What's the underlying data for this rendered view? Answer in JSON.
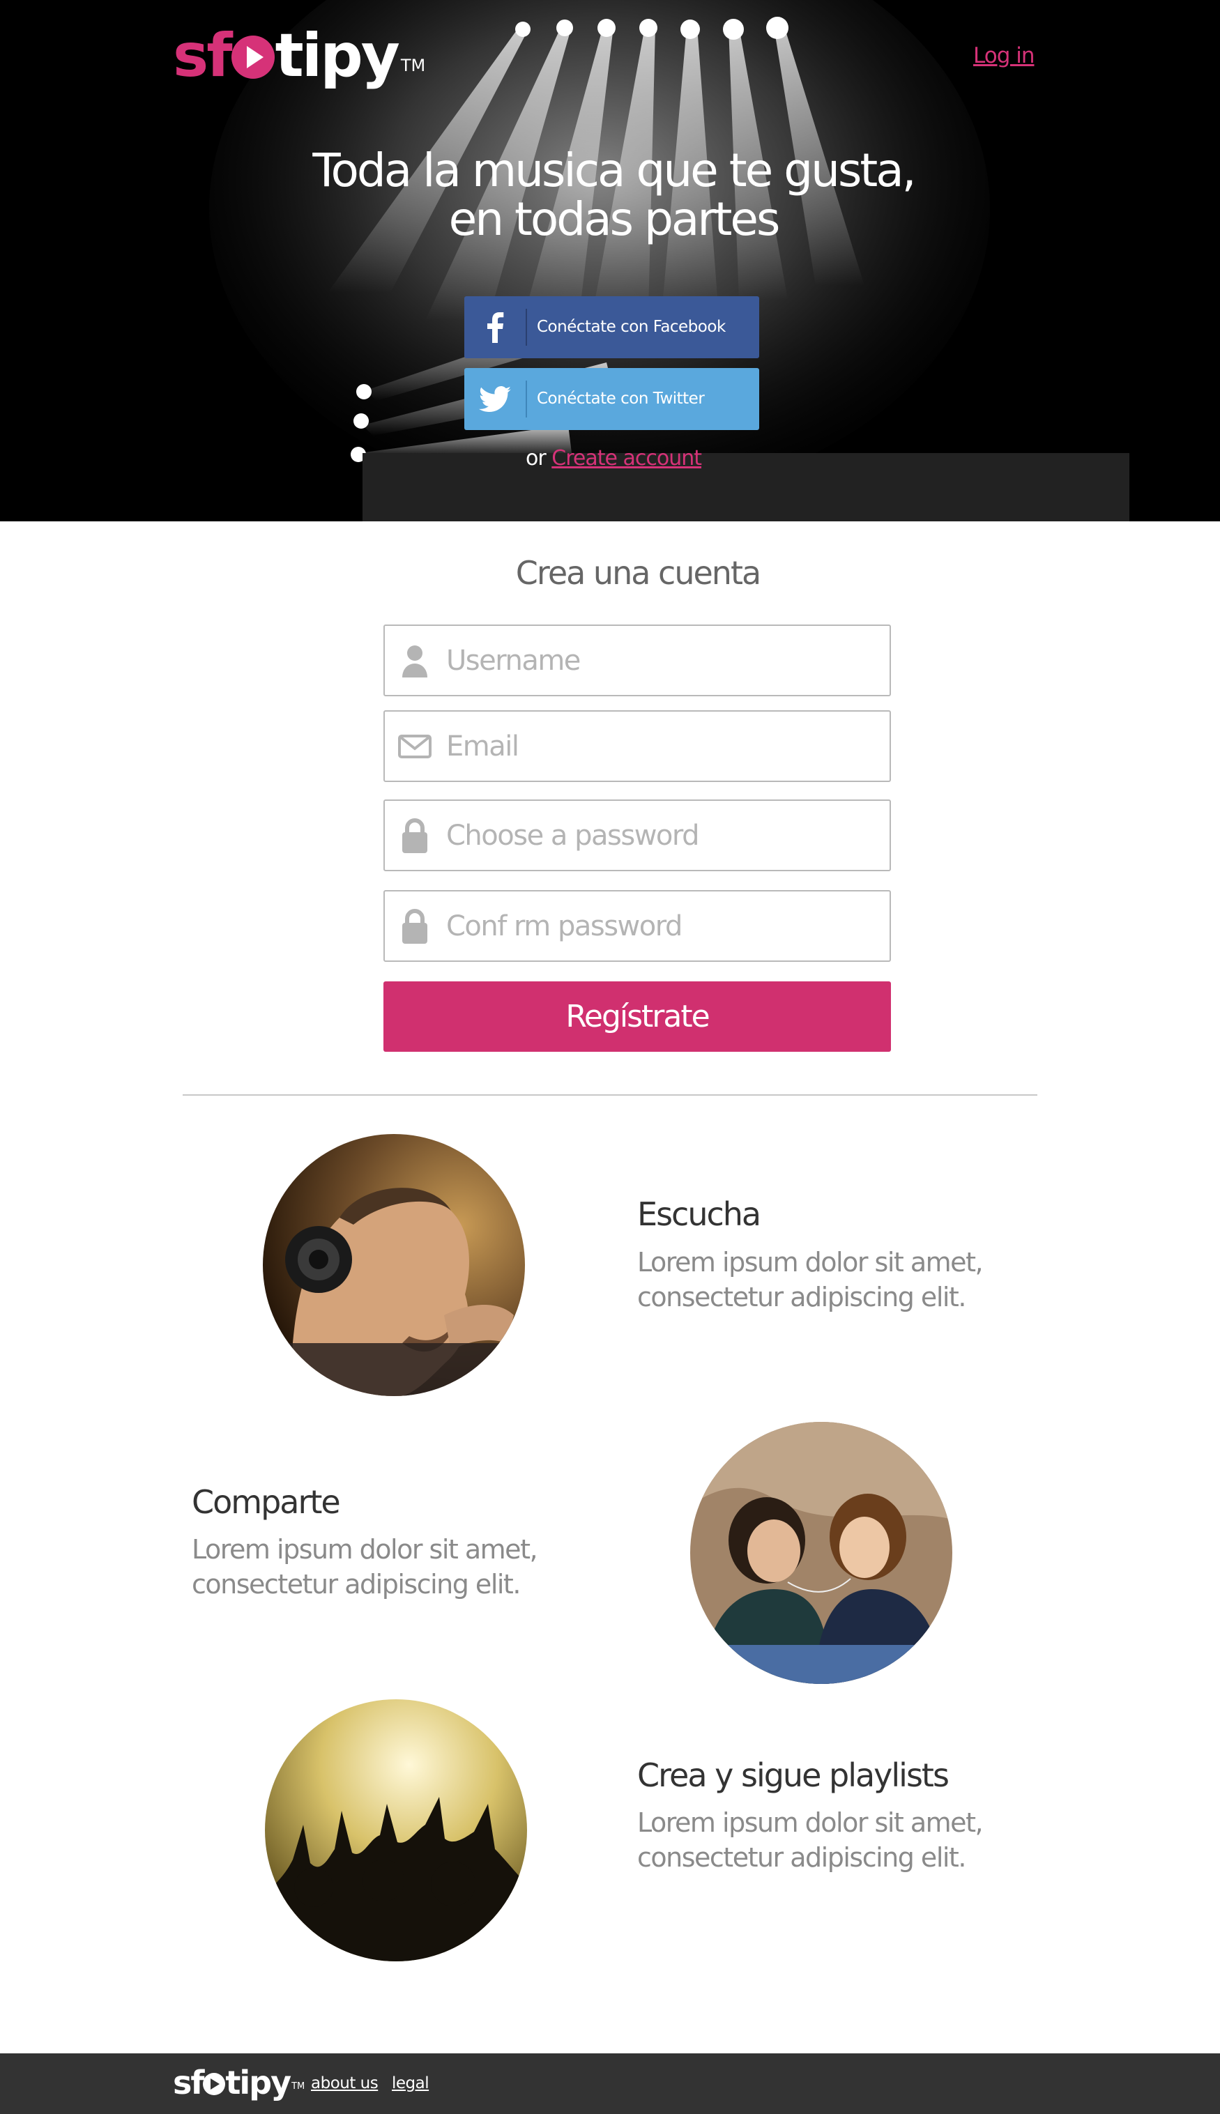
{
  "brand": {
    "logo_part1": "sf",
    "logo_part2": "tipy",
    "logo_tm": "TM",
    "accent_color": "#d63278"
  },
  "header": {
    "login_label": "Log in"
  },
  "hero": {
    "headline_line1": "Toda la musica que te gusta,",
    "headline_line2": "en todas partes",
    "facebook_label": "Conéctate con Facebook",
    "facebook_icon": "facebook-icon",
    "facebook_color": "#3b5998",
    "twitter_label": "Conéctate con Twitter",
    "twitter_icon": "twitter-icon",
    "twitter_color": "#5aa8dd",
    "or_text": "or",
    "create_account_label": "Create account"
  },
  "signup": {
    "title": "Crea una cuenta",
    "fields": [
      {
        "placeholder": "Username",
        "value": "",
        "icon": "user-icon"
      },
      {
        "placeholder": "Email",
        "value": "",
        "icon": "envelope-icon"
      },
      {
        "placeholder": "Choose a password",
        "value": "",
        "icon": "lock-icon"
      },
      {
        "placeholder": "Conf rm password",
        "value": "",
        "icon": "lock-icon"
      }
    ],
    "submit_label": "Regístrate",
    "submit_color": "#d0306f"
  },
  "features": [
    {
      "title": "Escucha",
      "line1": "Lorem ipsum dolor sit amet,",
      "line2": "consectetur adipiscing elit."
    },
    {
      "title": "Comparte",
      "line1": "Lorem ipsum dolor sit amet,",
      "line2": "consectetur adipiscing elit."
    },
    {
      "title": "Crea y sigue playlists",
      "line1": "Lorem ipsum dolor sit amet,",
      "line2": "consectetur adipiscing elit."
    }
  ],
  "footer": {
    "logo_part1": "sf",
    "logo_part2": "tipy",
    "logo_tm": "TM",
    "about_label": "about us",
    "legal_label": "legal"
  }
}
